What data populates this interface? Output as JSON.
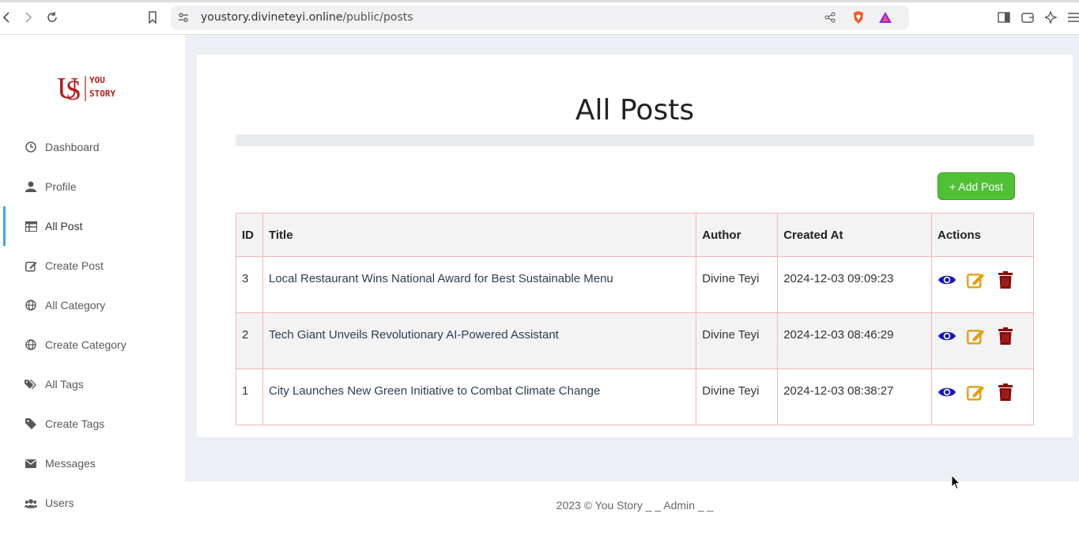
{
  "browser": {
    "url_host": "youstory.divineteyi.online",
    "url_path": "/public/posts"
  },
  "logo": {
    "line1": "YOU",
    "line2": "STORY"
  },
  "sidebar": {
    "items": [
      {
        "label": "Dashboard",
        "icon": "clock-icon"
      },
      {
        "label": "Profile",
        "icon": "user-icon"
      },
      {
        "label": "All Post",
        "icon": "table-icon",
        "active": true
      },
      {
        "label": "Create Post",
        "icon": "edit-icon"
      },
      {
        "label": "All Category",
        "icon": "globe-icon"
      },
      {
        "label": "Create Category",
        "icon": "globe-icon"
      },
      {
        "label": "All Tags",
        "icon": "tags-icon"
      },
      {
        "label": "Create Tags",
        "icon": "tag-icon"
      },
      {
        "label": "Messages",
        "icon": "envelope-icon"
      },
      {
        "label": "Users",
        "icon": "users-icon"
      }
    ]
  },
  "main": {
    "title": "All Posts",
    "add_button": "+ Add Post",
    "table": {
      "headers": [
        "ID",
        "Title",
        "Author",
        "Created At",
        "Actions"
      ],
      "rows": [
        {
          "id": "3",
          "title": "Local Restaurant Wins National Award for Best Sustainable Menu",
          "author": "Divine Teyi",
          "created_at": "2024-12-03 09:09:23"
        },
        {
          "id": "2",
          "title": "Tech Giant Unveils Revolutionary AI-Powered Assistant",
          "author": "Divine Teyi",
          "created_at": "2024-12-03 08:46:29"
        },
        {
          "id": "1",
          "title": "City Launches New Green Initiative to Combat Climate Change",
          "author": "Divine Teyi",
          "created_at": "2024-12-03 08:38:27"
        }
      ]
    }
  },
  "footer": {
    "text": "2023 © You Story _ _ Admin _ _"
  },
  "colors": {
    "view": "#1414c8",
    "edit": "#e0a010",
    "delete": "#8b0a0a",
    "add": "#50c035",
    "active": "#3fa2f7"
  }
}
